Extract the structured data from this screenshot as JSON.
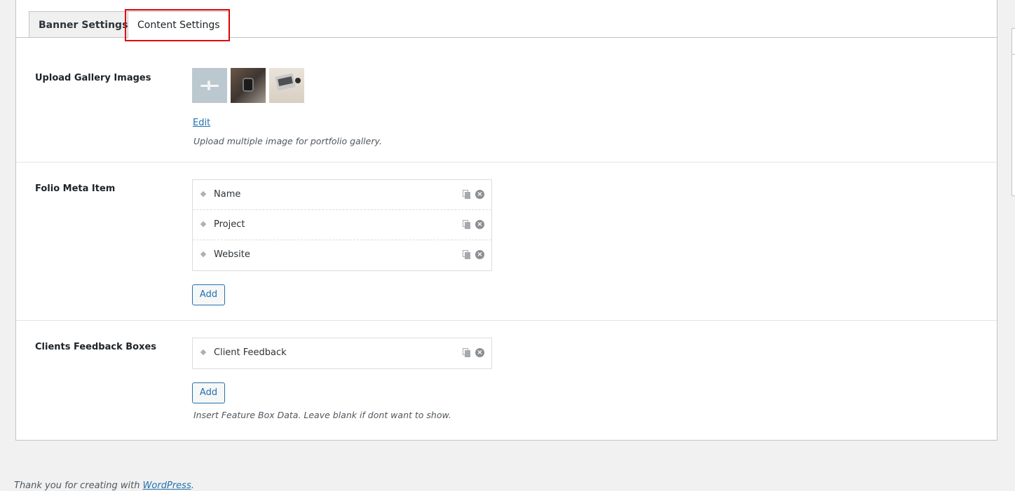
{
  "tabs": [
    {
      "label": "Banner Settings",
      "active": false
    },
    {
      "label": "Content Settings",
      "active": true
    }
  ],
  "gallery": {
    "label": "Upload Gallery Images",
    "edit_label": "Edit",
    "description": "Upload multiple image for portfolio gallery."
  },
  "folio_meta": {
    "label": "Folio Meta Item",
    "items": [
      {
        "label": "Name"
      },
      {
        "label": "Project"
      },
      {
        "label": "Website"
      }
    ],
    "add_label": "Add"
  },
  "feedback": {
    "label": "Clients Feedback Boxes",
    "items": [
      {
        "label": "Client Feedback"
      }
    ],
    "add_label": "Add",
    "description": "Insert Feature Box Data. Leave blank if dont want to show."
  },
  "footer": {
    "text": "Thank you for creating with ",
    "link": "WordPress",
    "suffix": "."
  },
  "colors": {
    "accent": "#2271b1",
    "highlight": "#e00000"
  }
}
